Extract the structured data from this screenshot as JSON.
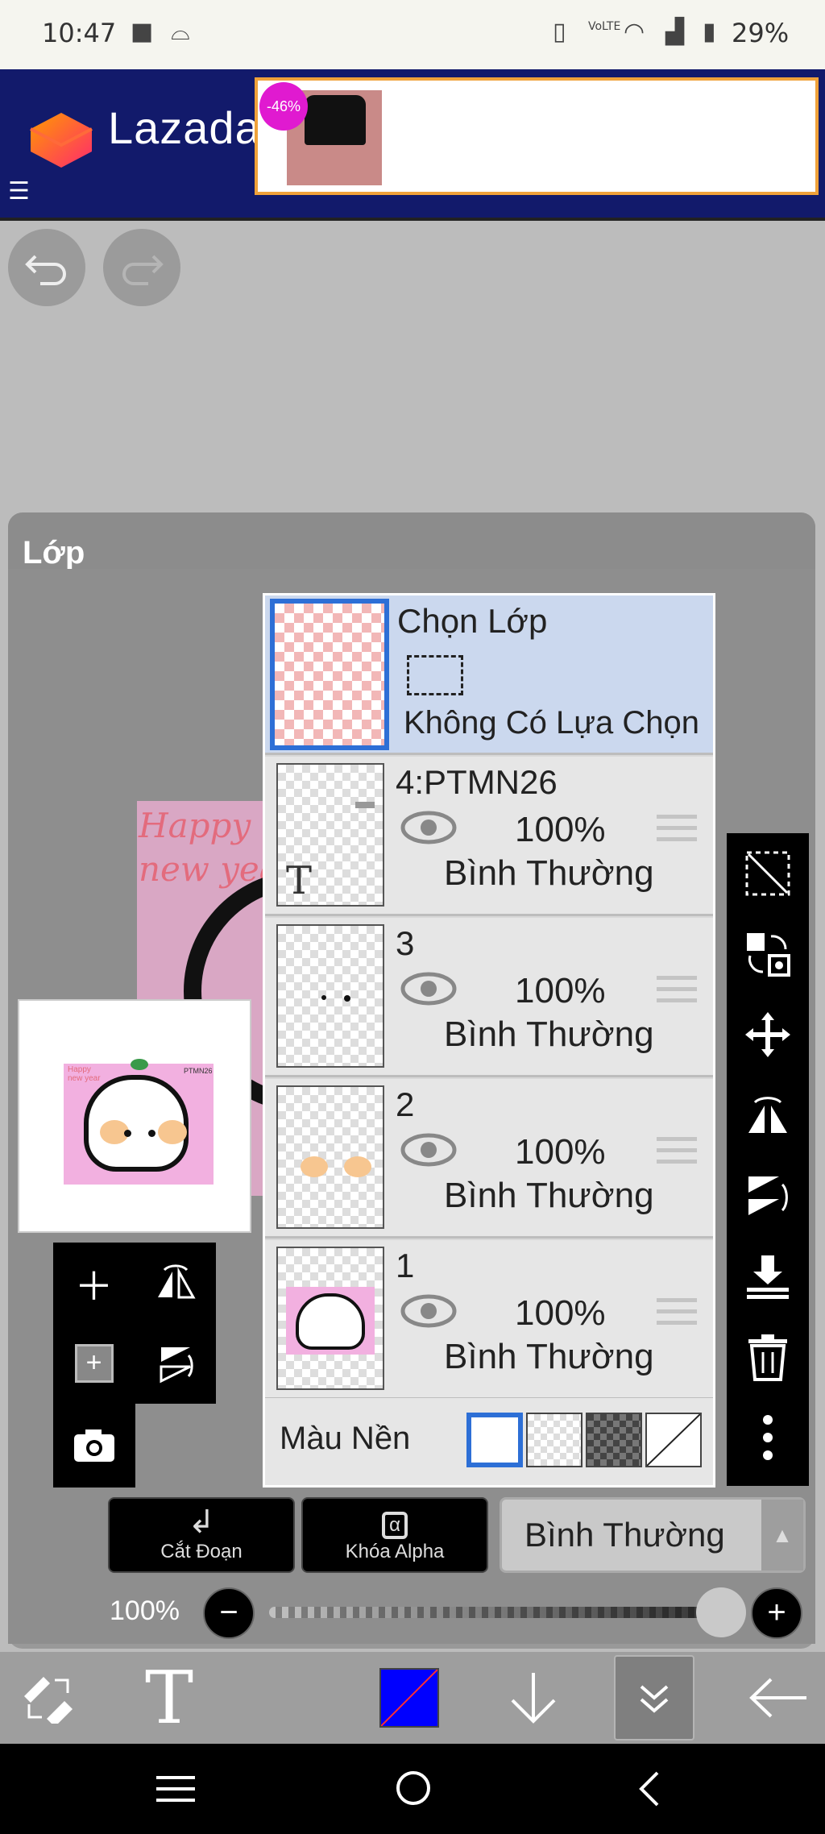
{
  "statusbar": {
    "time": "10:47",
    "battery": "29%",
    "icons": [
      "stop-icon",
      "incognito-icon",
      "vibrate-icon",
      "volte-icon",
      "wifi-icon",
      "signal-icon",
      "battery-icon"
    ],
    "volte": "VoLTE"
  },
  "ad": {
    "brand": "Lazada",
    "discount": "-46%",
    "accent": "#f0a23a",
    "bg": "#121a6b"
  },
  "panel": {
    "title": "Lớp"
  },
  "selection_layer": {
    "title": "Chọn Lớp",
    "subtitle": "Không Có Lựa Chọn"
  },
  "layers": [
    {
      "name": "4:PTMN26",
      "opacity": "100%",
      "blend": "Bình Thường"
    },
    {
      "name": "3",
      "opacity": "100%",
      "blend": "Bình Thường"
    },
    {
      "name": "2",
      "opacity": "100%",
      "blend": "Bình Thường"
    },
    {
      "name": "1",
      "opacity": "100%",
      "blend": "Bình Thường"
    }
  ],
  "background_color": {
    "label": "Màu Nền"
  },
  "actions": {
    "clip_label": "Cắt Đoạn",
    "alpha_lock_label": "Khóa Alpha",
    "alpha_glyph": "α"
  },
  "blend_mode": {
    "value": "Bình Thường"
  },
  "opacity": {
    "label": "100%",
    "value": 100
  },
  "canvas_art": {
    "line1": "Happy",
    "line2": "new year",
    "tag": "PTMN26"
  },
  "colors": {
    "selection_highlight": "#cbd8ee",
    "selected_border": "#2d6fd6",
    "foreground_color": "#0000ff"
  }
}
